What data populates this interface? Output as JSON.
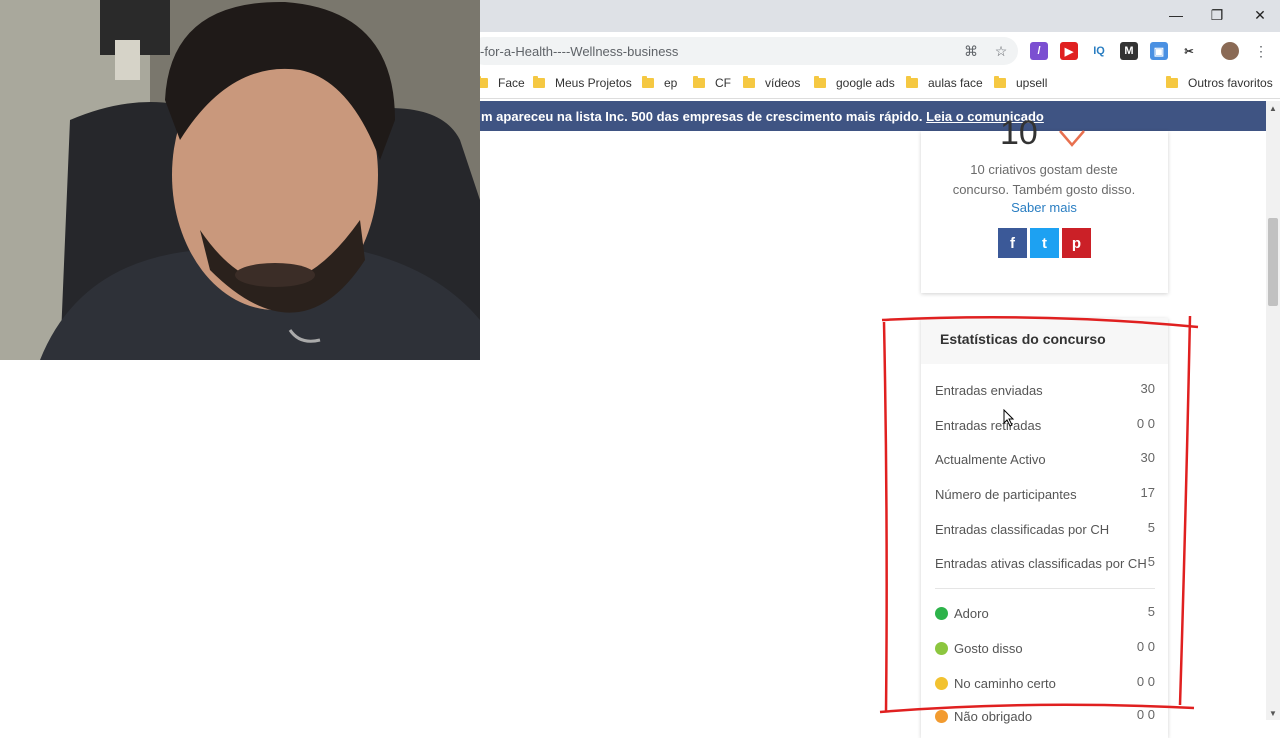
{
  "browser": {
    "url": "-for-a-Health----Wellness-business",
    "bookmarks": [
      "Face",
      "Meus Projetos",
      "ep",
      "CF",
      "vídeos",
      "google ads",
      "aulas face",
      "upsell"
    ],
    "other_bookmarks": "Outros favoritos",
    "window_buttons": {
      "minimize": "—",
      "restore": "❐",
      "close": "✕"
    }
  },
  "banner": {
    "text": "m apareceu na lista Inc. 500 das empresas de crescimento mais rápido. ",
    "link": "Leia o comunicado"
  },
  "likes": {
    "count": "10",
    "text_line1": "10 criativos gostam deste",
    "text_line2": "concurso. Também gosto disso.",
    "learn_more": "Saber mais"
  },
  "share": {
    "facebook": "f",
    "twitter": "t",
    "pinterest": "p",
    "colors": {
      "facebook": "#3b5998",
      "twitter": "#1da1f2",
      "pinterest": "#cb2027"
    }
  },
  "stats": {
    "title": "Estatísticas do concurso",
    "rows": [
      {
        "label": "Entradas enviadas",
        "value": "30"
      },
      {
        "label": "Entradas retiradas",
        "value": "0 0"
      },
      {
        "label": "Actualmente Activo",
        "value": "30"
      },
      {
        "label": "Número de participantes",
        "value": "17"
      },
      {
        "label": "Entradas classificadas por CH",
        "value": "5"
      },
      {
        "label": "Entradas ativas classificadas por CH",
        "value": "5"
      }
    ],
    "ratings": [
      {
        "label": "Adoro",
        "value": "5",
        "color": "#2db34a"
      },
      {
        "label": "Gosto disso",
        "value": "0 0",
        "color": "#8cc63f"
      },
      {
        "label": "No caminho certo",
        "value": "0 0",
        "color": "#f2c230"
      },
      {
        "label": "Não obrigado",
        "value": "0 0",
        "color": "#f29b30"
      }
    ]
  }
}
